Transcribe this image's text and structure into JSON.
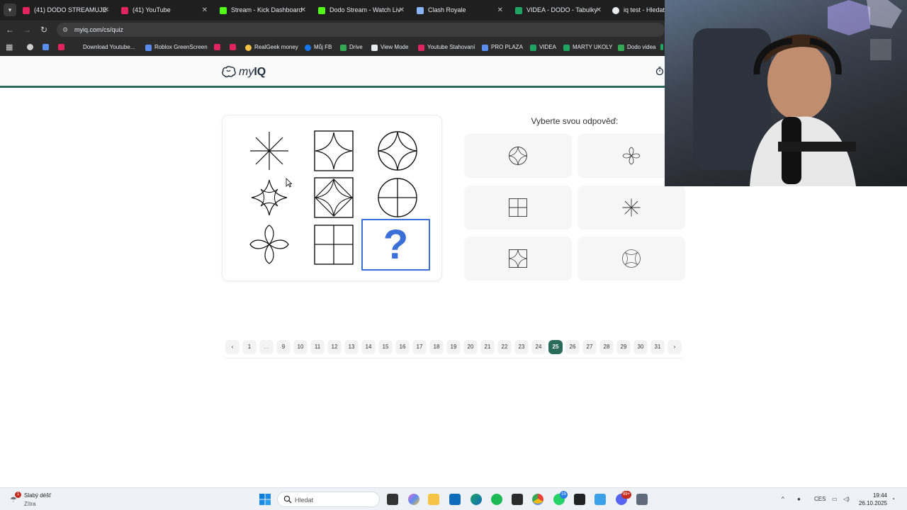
{
  "browser": {
    "tabs": [
      {
        "label": "(41) DODO STREAMUJE -",
        "favicon_color": "#e0245e"
      },
      {
        "label": "(41) YouTube",
        "favicon_color": "#e0245e"
      },
      {
        "label": "Stream - Kick Dashboard",
        "favicon_color": "#53fc18"
      },
      {
        "label": "Dodo Stream - Watch Liv",
        "favicon_color": "#53fc18"
      },
      {
        "label": "Clash Royale",
        "favicon_color": "#8ab4f8"
      },
      {
        "label": "VIDEA - DODO - Tabulky",
        "favicon_color": "#1fa463"
      },
      {
        "label": "iq test - Hledat G",
        "favicon_color": "#e8eaed"
      }
    ],
    "url": "myiq.com/cs/quiz",
    "bookmarks": [
      {
        "label": "",
        "favicon_color": "#cfcfcf"
      },
      {
        "label": "",
        "favicon_color": "#5b8def"
      },
      {
        "label": "",
        "favicon_color": "#e0245e"
      },
      {
        "label": "Download Youtube...",
        "favicon_color": ""
      },
      {
        "label": "Roblox GreenScreen",
        "favicon_color": "#5b8def"
      },
      {
        "label": "",
        "favicon_color": "#e0245e"
      },
      {
        "label": "",
        "favicon_color": "#e0245e"
      },
      {
        "label": "RealGeek money",
        "favicon_color": "#f6c244"
      },
      {
        "label": "Můj FB",
        "favicon_color": "#1877f2"
      },
      {
        "label": "Drive",
        "favicon_color": "#34a853"
      },
      {
        "label": "View Mode",
        "favicon_color": "#e8eaed"
      },
      {
        "label": "Youtube Stahovaní",
        "favicon_color": "#e0245e"
      },
      {
        "label": "PRO PLAZA",
        "favicon_color": "#5b8def"
      },
      {
        "label": "VIDEA",
        "favicon_color": "#1fa463"
      },
      {
        "label": "MARTY UKOLY",
        "favicon_color": "#1fa463"
      },
      {
        "label": "Dodo videa",
        "favicon_color": "#34a853"
      },
      {
        "label": "",
        "favicon_color": "#1fa463"
      }
    ]
  },
  "site": {
    "logo_prefix": "my",
    "logo_suffix": "IQ",
    "brand_color": "#2a6b5a"
  },
  "quiz": {
    "question_mark": "?",
    "answer_prompt": "Vyberte svou odpověď:",
    "accent_color": "#3a6fd8",
    "matrix_icons": [
      "asterisk-icon",
      "star-in-square-icon",
      "star-in-circle-icon",
      "four-point-star-icon",
      "petal-in-square-icon",
      "cross-in-circle-icon",
      "four-petal-flower-icon",
      "grid-in-square-icon",
      "missing-cell"
    ],
    "options": [
      {
        "icon": "star-in-circle-icon"
      },
      {
        "icon": "four-petal-flower-icon"
      },
      {
        "icon": "grid-in-square-icon"
      },
      {
        "icon": "asterisk-icon"
      },
      {
        "icon": "star-in-square-icon"
      },
      {
        "icon": "star-outline-circle-icon"
      }
    ]
  },
  "pagination": {
    "prev": "‹",
    "next": "›",
    "pages": [
      "1",
      "...",
      "9",
      "10",
      "11",
      "12",
      "13",
      "14",
      "15",
      "16",
      "17",
      "18",
      "19",
      "20",
      "21",
      "22",
      "23",
      "24",
      "25",
      "26",
      "27",
      "28",
      "29",
      "30",
      "31"
    ],
    "current": "25"
  },
  "taskbar": {
    "weather_title": "Slabý déšť",
    "weather_subtitle": "Zítra",
    "weather_badge": "1",
    "search_placeholder": "Hledat",
    "whatsapp_badge": "15",
    "discord_badge": "99+",
    "language": "CES",
    "time": "19:44",
    "date": "26.10.2025"
  }
}
